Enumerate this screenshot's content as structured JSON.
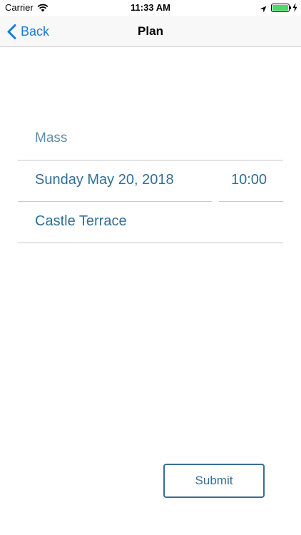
{
  "status_bar": {
    "carrier": "Carrier",
    "time": "11:33 AM",
    "battery_level": 1.0
  },
  "nav": {
    "back_label": "Back",
    "title": "Plan"
  },
  "form": {
    "event_type": "Mass",
    "date": "Sunday May 20, 2018",
    "time": "10:00",
    "location": "Castle Terrace"
  },
  "actions": {
    "submit_label": "Submit"
  },
  "colors": {
    "accent": "#1a7ad9",
    "field_text": "#2f6f94",
    "button_border": "#356f94"
  }
}
